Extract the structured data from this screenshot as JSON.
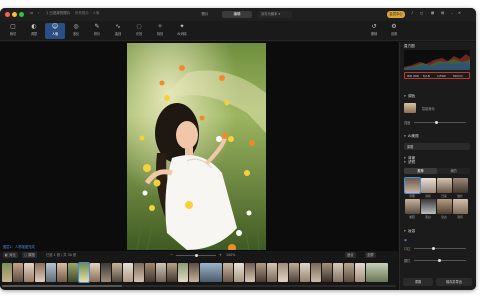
{
  "window": {
    "title_left": "1 已选择的照片",
    "title_sub": "所有照片 · 人像",
    "tabs": [
      "照片",
      "编辑"
    ],
    "active_tab": 1,
    "dropdown": "另存为副本 ▾",
    "vip_badge": "会员中心"
  },
  "toolbar": {
    "tools": [
      {
        "icon": "▢",
        "label": "裁切",
        "name": "crop"
      },
      {
        "icon": "◐",
        "label": "调整",
        "name": "adjust"
      },
      {
        "icon": "☺",
        "label": "人像",
        "name": "portrait"
      },
      {
        "icon": "◎",
        "label": "液化",
        "name": "liquify"
      },
      {
        "icon": "✎",
        "label": "修补",
        "name": "retouch"
      },
      {
        "icon": "∿",
        "label": "曲线",
        "name": "curves"
      },
      {
        "icon": "◌",
        "label": "光效",
        "name": "light"
      },
      {
        "icon": "✧",
        "label": "特效",
        "name": "effects"
      },
      {
        "icon": "✦",
        "label": "AI消除",
        "name": "ai-erase"
      }
    ],
    "active_tool": 2,
    "right_tools": [
      {
        "icon": "↺",
        "label": "撤销",
        "name": "undo"
      },
      {
        "icon": "⚙",
        "label": "设置",
        "name": "settings"
      }
    ]
  },
  "canvas": {
    "caption": "图层1：人物抠图完成"
  },
  "zoombar": {
    "left_buttons": [
      "◧ 对比",
      "□ 原图"
    ],
    "info": "已选 1 张 / 共 30 张",
    "zoom": "100%",
    "right_buttons": [
      "适合",
      "全屏"
    ]
  },
  "panel": {
    "histogram_title": "直方图",
    "exif": [
      "ISO 200",
      "f/2.8",
      "1/500",
      "50mm"
    ],
    "sections": [
      {
        "name": "调色",
        "value": ""
      },
      {
        "name": "AI美颜",
        "value": "AI"
      },
      {
        "name": "背景",
        "value": ""
      },
      {
        "name": "滤镜",
        "value": ""
      },
      {
        "name": "妆容",
        "value": ""
      }
    ],
    "smart_label": "智能美化",
    "smart_value": "强度",
    "bg_select": "原图",
    "filter_tabs": [
      "推荐",
      "我的"
    ],
    "filter_presets": [
      "原图",
      "清新",
      "日系",
      "胶片",
      "暖阳",
      "黑白",
      "复古",
      "港风"
    ],
    "makeup_labels": [
      "口红",
      "腮红"
    ],
    "btn_reset": "重置",
    "btn_save": "保存并导出"
  },
  "colors": {
    "accent": "#2b4f85",
    "exif_border": "#c0392b",
    "vip": "#d8a33a"
  }
}
